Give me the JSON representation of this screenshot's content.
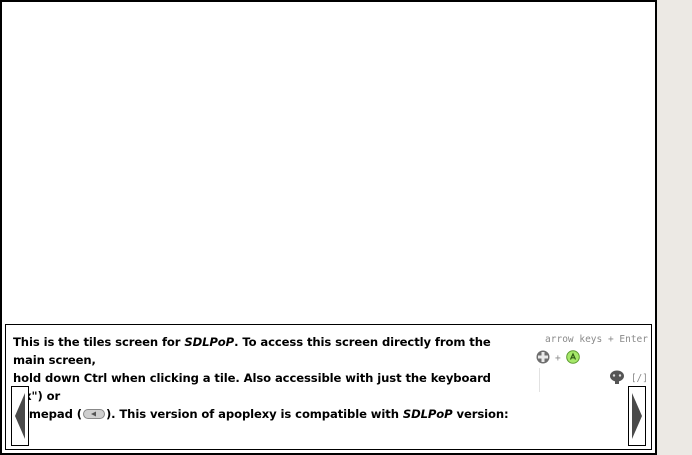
{
  "info": {
    "line1_a": "This is the tiles screen for ",
    "line1_app": "SDLPoP",
    "line1_b": ". To access this screen directly from the main screen,",
    "line2": "hold down Ctrl when clicking a tile. Also accessible with just the keyboard (\"x\") or",
    "line3_a": "gamepad (",
    "line3_b": "). This version of apoplexy is compatible with ",
    "line3_app": "SDLPoP",
    "line3_c": " version:"
  },
  "hints": {
    "keys": "arrow keys + Enter",
    "plus": "+",
    "slash": "[/]"
  },
  "icons": {
    "gamepad_button": "gamepad-shoulder-button-icon",
    "dpad": "dpad-icon",
    "a_button": "a-button-icon",
    "shoulder": "gamepad-small-icon",
    "prev": "previous-arrow-icon",
    "next": "next-arrow-icon"
  },
  "colors": {
    "background": "#ece9e4",
    "panel": "#ffffff",
    "hint_text": "#8a8a8a",
    "a_button": "#a6e86a"
  }
}
